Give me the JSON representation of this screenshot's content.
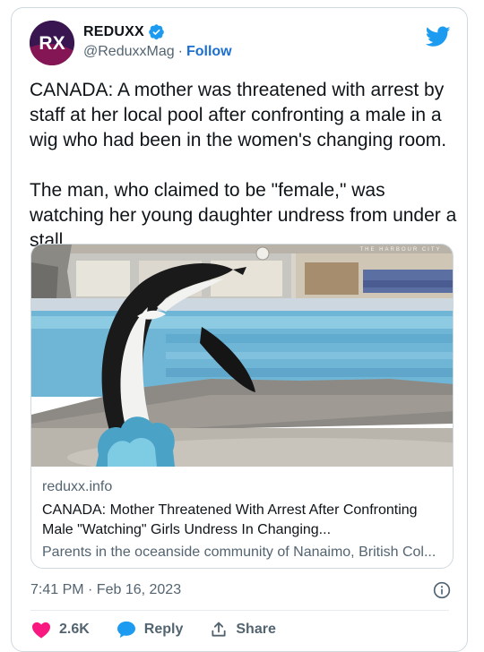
{
  "account": {
    "display_name": "REDUXX",
    "handle": "@ReduxxMag",
    "separator": "·",
    "follow_label": "Follow",
    "avatar_text": "RX",
    "verified": true
  },
  "tweet": {
    "paragraphs": [
      "CANADA: A mother was threatened with arrest by staff at her local pool after confronting a male in a wig who had been in the women's changing room.",
      "The man, who claimed to be \"female,\" was watching her young daughter undress from under a stall."
    ],
    "timestamp": "7:41 PM · Feb 16, 2023"
  },
  "link_card": {
    "domain": "reduxx.info",
    "headline": "CANADA: Mother Threatened With Arrest After Confronting Male \"Watching\" Girls Undress In Changing...",
    "description": "Parents in the oceanside community of Nanaimo, British Col...",
    "image_sign_text": "THE HARBOUR CITY"
  },
  "actions": {
    "likes": "2.6K",
    "reply_label": "Reply",
    "share_label": "Share"
  },
  "colors": {
    "brand_blue": "#1d9bf0",
    "like_red": "#f91880",
    "link_blue": "#1d6fd0",
    "muted": "#536471",
    "avatar_bg": "#3b1752"
  },
  "icons": [
    "verified-badge-icon",
    "twitter-bird-icon",
    "info-icon",
    "heart-icon",
    "reply-bubble-icon",
    "share-icon"
  ]
}
